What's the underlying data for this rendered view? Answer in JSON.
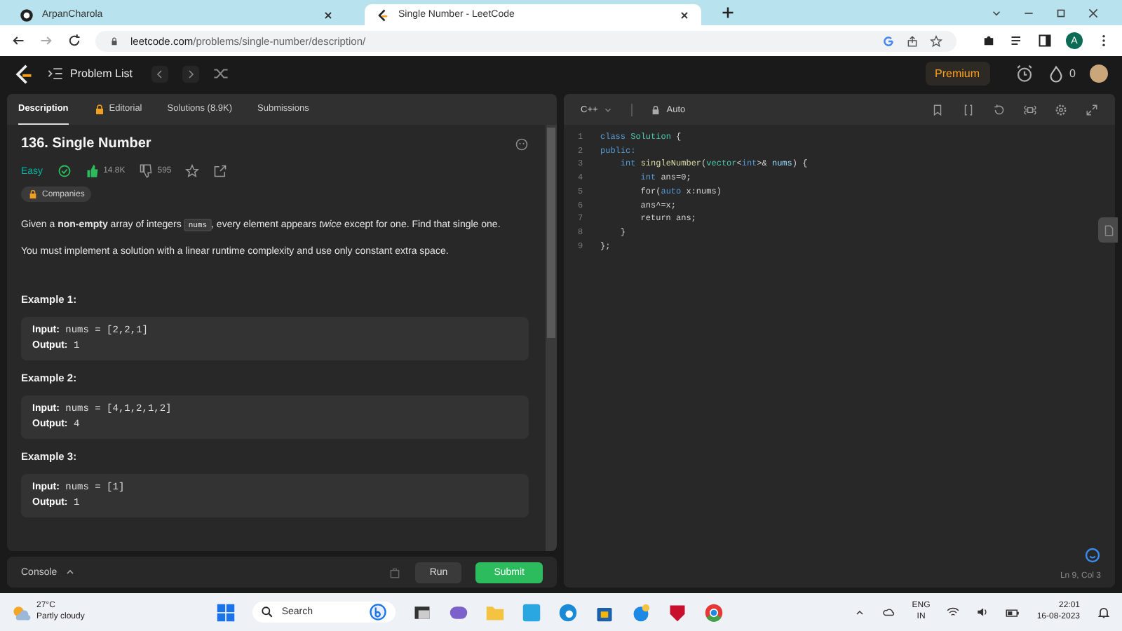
{
  "browser": {
    "tabs": [
      {
        "title": "ArpanCharola",
        "selected": false
      },
      {
        "title": "Single Number - LeetCode",
        "selected": true
      }
    ],
    "url": {
      "host": "leetcode.com",
      "path": "/problems/single-number/description/"
    },
    "profile_initial": "A"
  },
  "header": {
    "problem_list": "Problem List",
    "premium": "Premium",
    "streak": "0"
  },
  "description": {
    "tabs": [
      {
        "label": "Description",
        "selected": true,
        "locked": false
      },
      {
        "label": "Editorial",
        "selected": false,
        "locked": true
      },
      {
        "label": "Solutions (8.9K)",
        "selected": false,
        "locked": false
      },
      {
        "label": "Submissions",
        "selected": false,
        "locked": false
      }
    ],
    "title": "136. Single Number",
    "difficulty": "Easy",
    "likes": "14.8K",
    "dislikes": "595",
    "companies": "Companies",
    "paragraphs": [
      [
        {
          "kind": "text",
          "text": "Given a **non-empty** array of integers "
        },
        {
          "kind": "code",
          "text": "nums"
        },
        {
          "kind": "text",
          "text": ", every element appears *twice* except for one. Find that single one."
        }
      ],
      [
        {
          "kind": "text",
          "text": "You must implement a solution with a linear runtime complexity and use only constant extra space."
        }
      ]
    ],
    "examples": [
      {
        "heading": "Example 1:",
        "lines": [
          "**Input:** nums = [2,2,1]",
          "**Output:** 1"
        ]
      },
      {
        "heading": "Example 2:",
        "lines": [
          "**Input:** nums = [4,1,2,1,2]",
          "**Output:** 4"
        ]
      },
      {
        "heading": "Example 3:",
        "lines": [
          "**Input:** nums = [1]",
          "**Output:** 1"
        ]
      }
    ]
  },
  "console": {
    "label": "Console",
    "run": "Run",
    "submit": "Submit"
  },
  "editor": {
    "language": "C++",
    "mode": "Auto",
    "cursor": "Ln 9, Col 3",
    "lines": [
      {
        "number": "1",
        "tokens": [
          {
            "kind": "kw",
            "text": "class"
          },
          {
            "kind": "type",
            "text": " Solution"
          },
          {
            "kind": "plain",
            "text": " {"
          }
        ]
      },
      {
        "number": "2",
        "tokens": [
          {
            "kind": "kw",
            "text": "public:"
          }
        ]
      },
      {
        "number": "3",
        "tokens": [
          {
            "kind": "kw",
            "text": "    int"
          },
          {
            "kind": "fn",
            "text": " singleNumber"
          },
          {
            "kind": "plain",
            "text": "("
          },
          {
            "kind": "type",
            "text": "vector"
          },
          {
            "kind": "plain",
            "text": "<"
          },
          {
            "kind": "kw",
            "text": "int"
          },
          {
            "kind": "plain",
            "text": ">& "
          },
          {
            "kind": "var",
            "text": "nums"
          },
          {
            "kind": "plain",
            "text": ") {"
          }
        ]
      },
      {
        "number": "4",
        "tokens": [
          {
            "kind": "kw",
            "text": "        int"
          },
          {
            "kind": "plain",
            "text": " ans=0;"
          }
        ]
      },
      {
        "number": "5",
        "tokens": [
          {
            "kind": "plain",
            "text": "        for("
          },
          {
            "kind": "kw",
            "text": "auto"
          },
          {
            "kind": "plain",
            "text": " x:nums)"
          }
        ]
      },
      {
        "number": "6",
        "tokens": [
          {
            "kind": "plain",
            "text": "        ans^=x;"
          }
        ]
      },
      {
        "number": "7",
        "tokens": [
          {
            "kind": "plain",
            "text": "        return ans;"
          }
        ]
      },
      {
        "number": "8",
        "tokens": [
          {
            "kind": "plain",
            "text": "    }"
          }
        ]
      },
      {
        "number": "9",
        "tokens": [
          {
            "kind": "plain",
            "text": "};"
          }
        ]
      }
    ]
  },
  "taskbar": {
    "temperature": "27°C",
    "weather": "Partly cloudy",
    "search": "Search",
    "language": "ENG",
    "region": "IN",
    "time": "22:01",
    "date": "16-08-2023"
  }
}
